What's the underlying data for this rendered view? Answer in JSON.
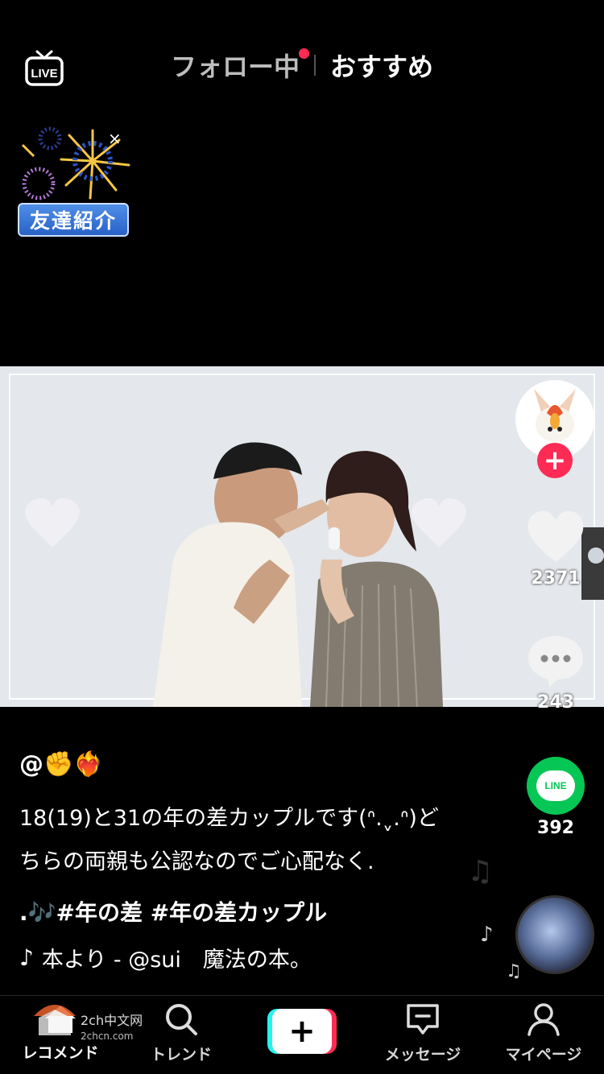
{
  "header": {
    "live_label": "LIVE",
    "tab_following": "フォロー中",
    "tab_recommended": "おすすめ"
  },
  "invite": {
    "label": "友達紹介",
    "close": "×"
  },
  "rail": {
    "likes": "2371",
    "comments": "243",
    "shares": "392",
    "line_label": "LINE",
    "follow_plus": "+"
  },
  "post": {
    "username": "@✊❤️‍🔥",
    "caption_line1": "18(19)と31の年の差カップルです(ᐢ.ˬ.ᐢ)ど",
    "caption_line2": "ちらの両親も公認なのでご心配なく.",
    "tags": ".🎶#年の差 #年の差カップル",
    "music": "本より - @sui　魔法の本。"
  },
  "nav": {
    "home": "レコメンド",
    "trend": "トレンド",
    "create": "+",
    "messages": "メッセージ",
    "profile": "マイページ"
  },
  "watermark": {
    "site": "2ch中文网",
    "url": "2chcn.com"
  },
  "colors": {
    "accent_red": "#fe2c55",
    "accent_cyan": "#25f4ee",
    "line_green": "#06c755"
  }
}
